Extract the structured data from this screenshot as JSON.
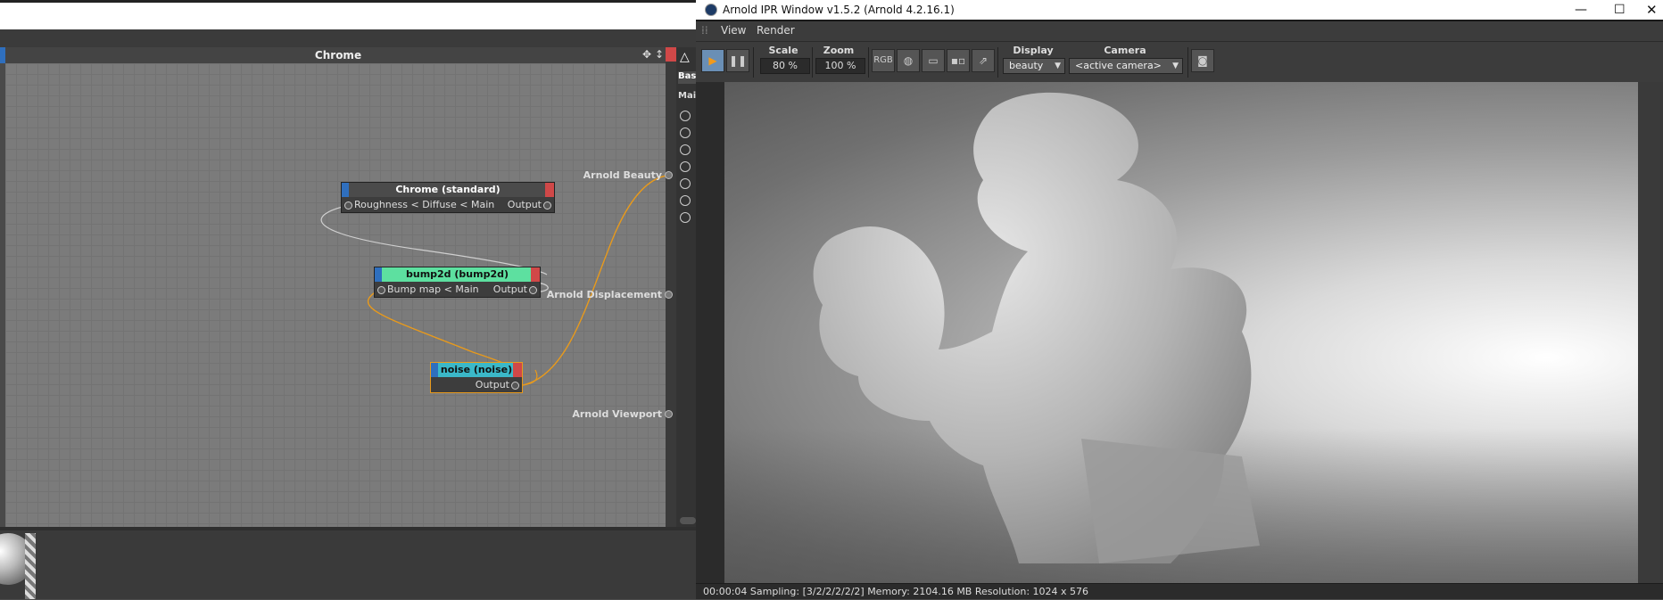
{
  "node_editor": {
    "title": "Chrome",
    "nodes": [
      {
        "title": "Chrome (standard)",
        "input": "Roughness < Diffuse < Main",
        "output": "Output"
      },
      {
        "title": "bump2d (bump2d)",
        "input": "Bump map < Main",
        "output": "Output"
      },
      {
        "title": "noise (noise)",
        "output": "Output"
      }
    ],
    "outputs": [
      "Arnold Beauty",
      "Arnold Displacement",
      "Arnold Viewport"
    ],
    "side_panel": {
      "tab": "Bas",
      "section": "Mai"
    }
  },
  "ipr": {
    "title": "Arnold IPR Window v1.5.2 (Arnold 4.2.16.1)",
    "menu": [
      "View",
      "Render"
    ],
    "toolbar": {
      "scale_label": "Scale",
      "scale_value": "80 %",
      "zoom_label": "Zoom",
      "zoom_value": "100 %",
      "rgb_label": "RGB",
      "display_label": "Display",
      "display_value": "beauty",
      "camera_label": "Camera",
      "camera_value": "<active camera>"
    },
    "status": "00:00:04  Sampling: [3/2/2/2/2/2]  Memory: 2104.16 MB  Resolution: 1024 x 576"
  },
  "colors": {
    "accent_orange": "#e89a1c",
    "node_blue": "#2f6fbe",
    "node_red": "#d04848",
    "bump_green": "#5de0a0",
    "noise_teal": "#3bb8c8"
  }
}
